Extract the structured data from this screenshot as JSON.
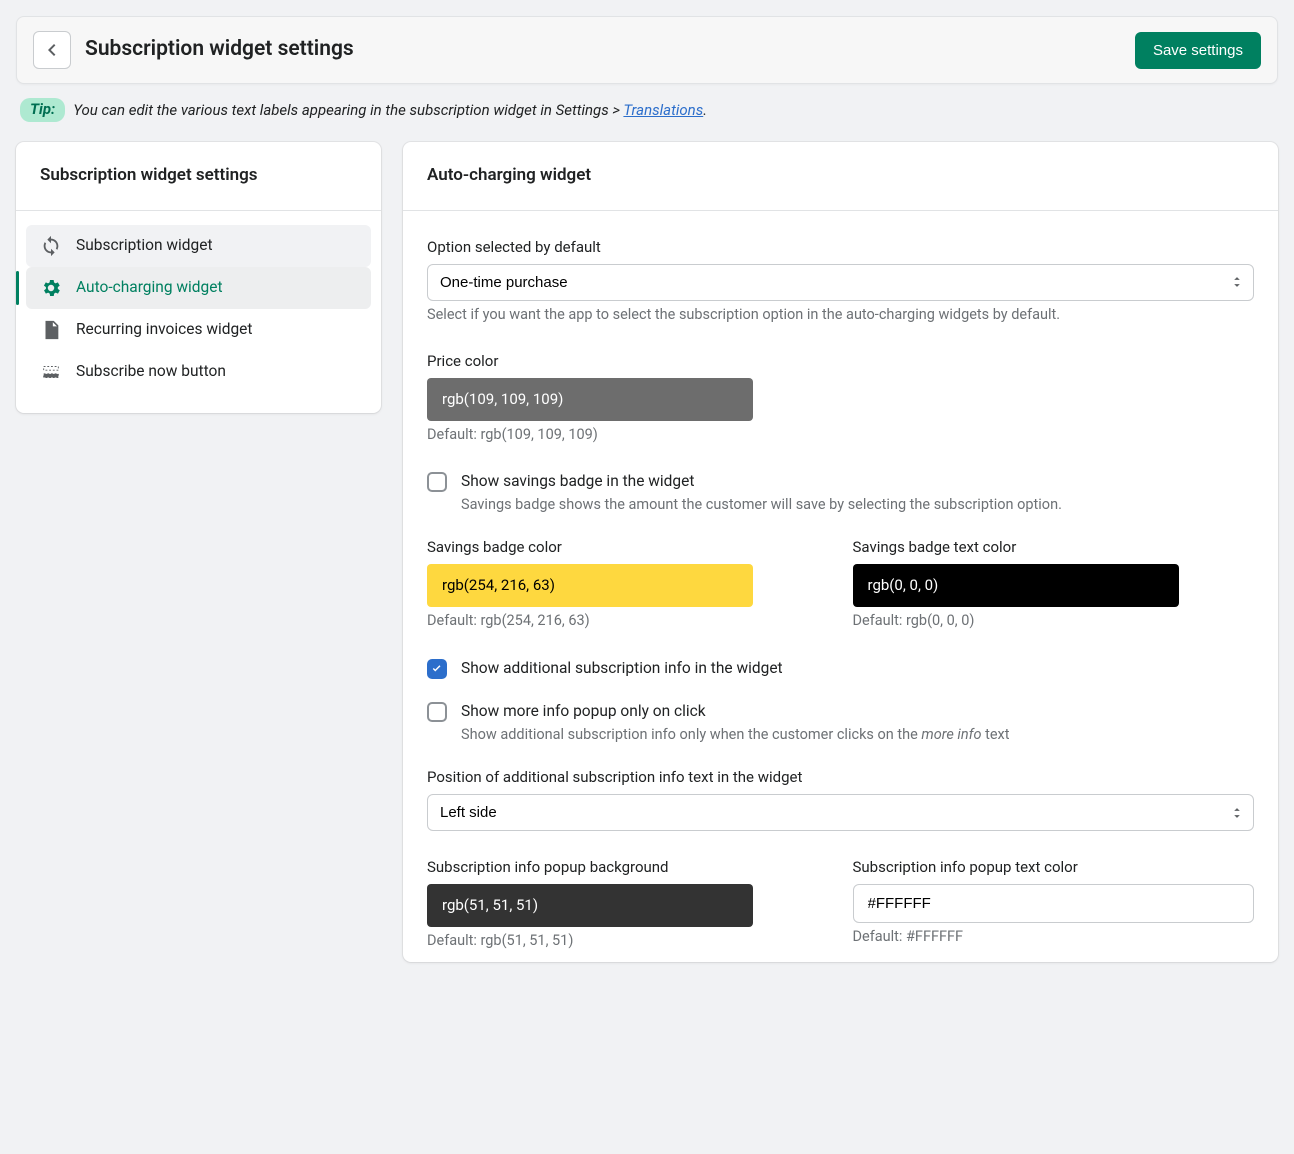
{
  "header": {
    "title": "Subscription widget settings",
    "save": "Save settings"
  },
  "tip": {
    "badge": "Tip:",
    "text": "You can edit the various text labels appearing in the subscription widget in Settings > ",
    "link": "Translations",
    "after": "."
  },
  "sidebar": {
    "title": "Subscription widget settings",
    "items": [
      {
        "label": "Subscription widget"
      },
      {
        "label": "Auto-charging widget"
      },
      {
        "label": "Recurring invoices widget"
      },
      {
        "label": "Subscribe now button"
      }
    ]
  },
  "main": {
    "title": "Auto-charging widget",
    "option_default": {
      "label": "Option selected by default",
      "value": "One-time purchase",
      "help": "Select if you want the app to select the subscription option in the auto-charging widgets by default."
    },
    "price_color": {
      "label": "Price color",
      "value": "rgb(109, 109, 109)",
      "swatch": "#6d6d6d",
      "text": "#fff",
      "default": "Default: rgb(109, 109, 109)"
    },
    "show_savings": {
      "label": "Show savings badge in the widget",
      "help": "Savings badge shows the amount the customer will save by selecting the subscription option.",
      "checked": false
    },
    "savings_badge_color": {
      "label": "Savings badge color",
      "value": "rgb(254, 216, 63)",
      "swatch": "#fed83f",
      "text": "#000",
      "default": "Default: rgb(254, 216, 63)"
    },
    "savings_badge_text_color": {
      "label": "Savings badge text color",
      "value": "rgb(0, 0, 0)",
      "swatch": "#000000",
      "text": "#fff",
      "default": "Default: rgb(0, 0, 0)"
    },
    "show_additional": {
      "label": "Show additional subscription info in the widget",
      "checked": true
    },
    "show_more_click": {
      "label": "Show more info popup only on click",
      "help_pre": "Show additional subscription info only when the customer clicks on the ",
      "help_em": "more info",
      "help_post": " text",
      "checked": false
    },
    "position_info": {
      "label": "Position of additional subscription info text in the widget",
      "value": "Left side"
    },
    "popup_bg": {
      "label": "Subscription info popup background",
      "value": "rgb(51, 51, 51)",
      "swatch": "#333333",
      "text": "#fff",
      "default": "Default: rgb(51, 51, 51)"
    },
    "popup_text": {
      "label": "Subscription info popup text color",
      "value": "#FFFFFF",
      "default": "Default: #FFFFFF"
    }
  }
}
